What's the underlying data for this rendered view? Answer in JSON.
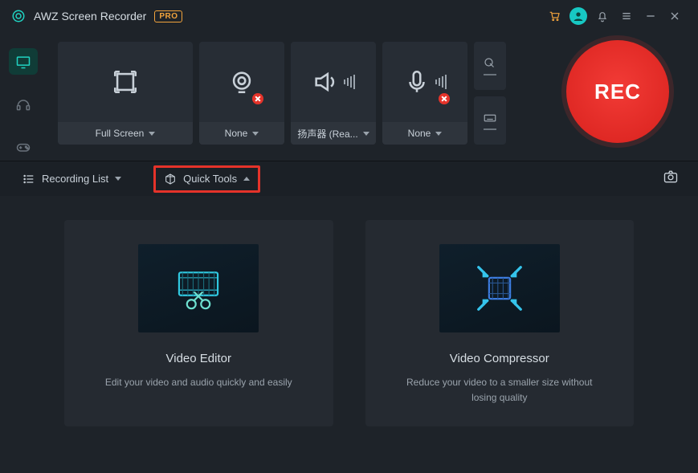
{
  "titlebar": {
    "app_title": "AWZ Screen Recorder",
    "pro_badge": "PRO"
  },
  "tiles": {
    "region_label": "Full Screen",
    "webcam_label": "None",
    "speaker_label": "扬声器 (Rea...",
    "mic_label": "None"
  },
  "rec_label": "REC",
  "toolbar": {
    "recording_list": "Recording List",
    "quick_tools": "Quick Tools"
  },
  "cards": {
    "editor": {
      "title": "Video Editor",
      "desc": "Edit your video and audio quickly and easily"
    },
    "compressor": {
      "title": "Video Compressor",
      "desc": "Reduce your video to a smaller size without losing quality"
    }
  }
}
